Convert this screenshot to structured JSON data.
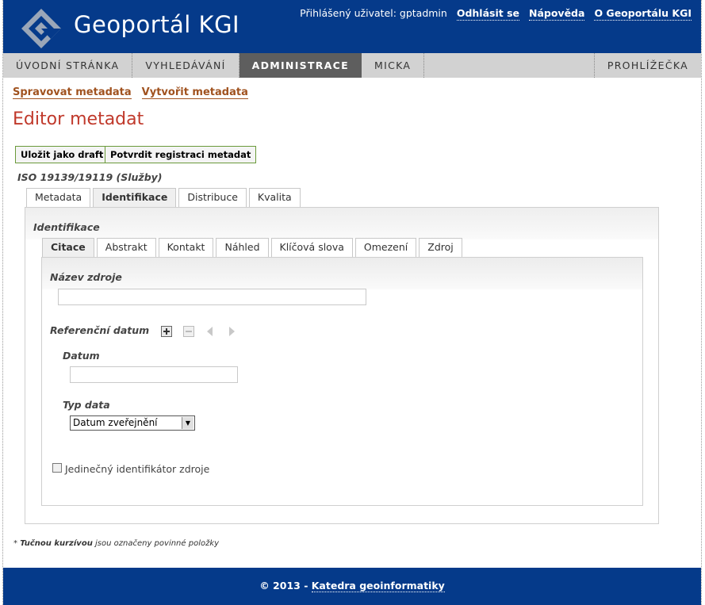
{
  "header": {
    "site_title": "Geoportál KGI",
    "logged_user_text": "Přihlášený uživatel: gptadmin",
    "logout_label": "Odhlásit se",
    "help_label": "Nápověda",
    "about_label": "O Geoportálu KGI"
  },
  "nav": {
    "items": [
      {
        "label": "ÚVODNÍ STRÁNKA"
      },
      {
        "label": "VYHLEDÁVÁNÍ"
      },
      {
        "label": "ADMINISTRACE"
      },
      {
        "label": "MICKA"
      },
      {
        "label": "PROHLÍŽEČKA"
      }
    ],
    "active_index": 2
  },
  "sublinks": {
    "manage": "Spravovat metadata",
    "create": "Vytvořit metadata"
  },
  "page_title": "Editor metadat",
  "buttons": {
    "save_draft": "Uložit jako draft",
    "confirm_registration": "Potvrdit registraci metadat"
  },
  "standard_label": "ISO 19139/19119 (Služby)",
  "main_tabs": [
    {
      "label": "Metadata"
    },
    {
      "label": "Identifikace"
    },
    {
      "label": "Distribuce"
    },
    {
      "label": "Kvalita"
    }
  ],
  "main_tabs_active": 1,
  "section_label": "Identifikace",
  "sub_tabs": [
    {
      "label": "Citace"
    },
    {
      "label": "Abstrakt"
    },
    {
      "label": "Kontakt"
    },
    {
      "label": "Náhled"
    },
    {
      "label": "Klíčová slova"
    },
    {
      "label": "Omezení"
    },
    {
      "label": "Zdroj"
    }
  ],
  "sub_tabs_active": 0,
  "form": {
    "resource_name_label": "Název zdroje",
    "resource_name_value": "",
    "ref_date_label": "Referenční datum",
    "date_label": "Datum",
    "date_value": "",
    "date_type_label": "Typ data",
    "date_type_value": "Datum zveřejnění",
    "unique_id_label": "Jedinečný identifikátor zdroje",
    "unique_id_checked": false
  },
  "footnote": {
    "star": "*",
    "bold": "Tučnou kurzívou",
    "rest": "jsou označeny povinné položky"
  },
  "footer": {
    "copyright": "© 2013 -",
    "link": "Katedra geoinformatiky"
  },
  "colors": {
    "header_bg": "#053a8a",
    "nav_bg": "#d2d2d2",
    "nav_active_bg": "#5e5e5e",
    "link_color": "#a0521f",
    "title_color": "#c0392b",
    "button_border": "#6a9a3a"
  }
}
